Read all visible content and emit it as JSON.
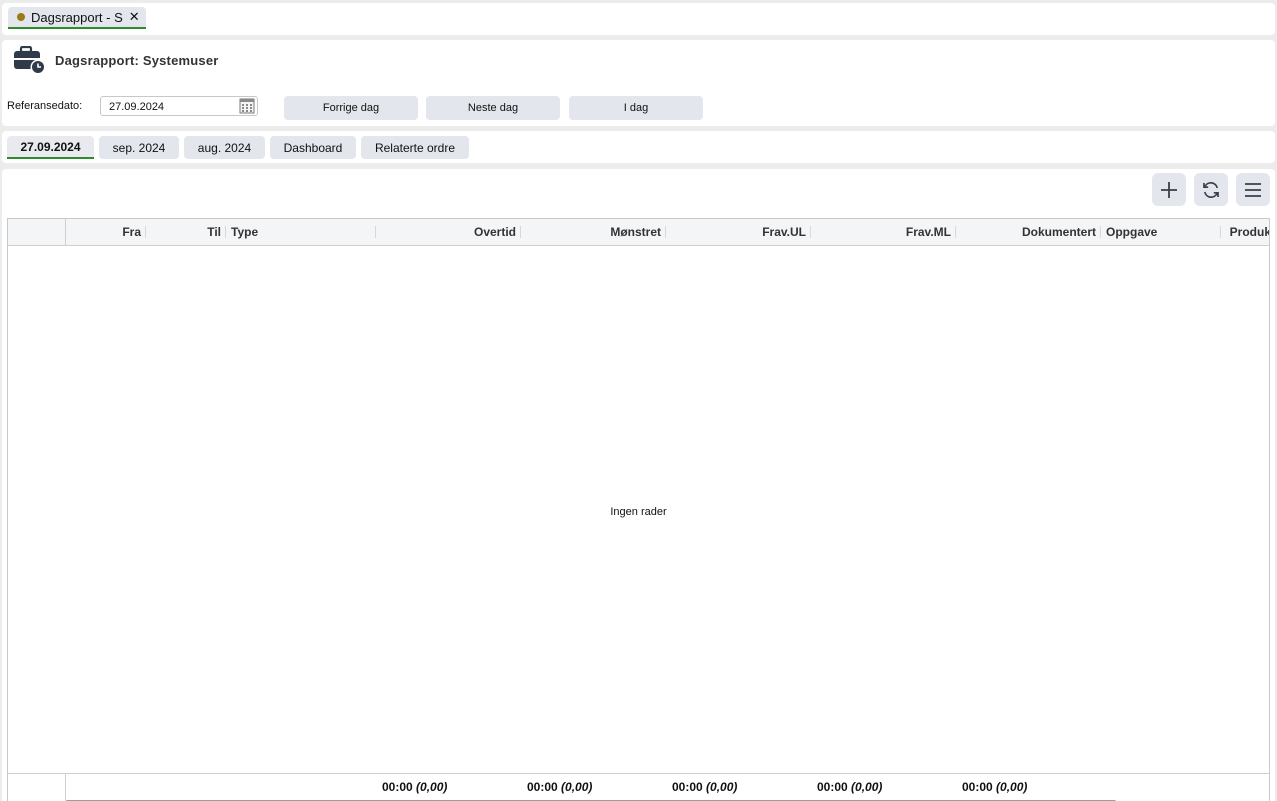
{
  "tabbar": {
    "tab_label": "Dagsrapport - S",
    "close_glyph": "✕",
    "dot_color": "#9a7b12"
  },
  "header": {
    "title": "Dagsrapport: Systemuser",
    "ref_label": "Referansedato:",
    "date_value": "27.09.2024",
    "buttons": {
      "prev": "Forrige dag",
      "next": "Neste dag",
      "today": "I dag"
    }
  },
  "subtabs": [
    "27.09.2024",
    "sep. 2024",
    "aug. 2024",
    "Dashboard",
    "Relaterte ordre"
  ],
  "toolbar": {
    "icons": [
      "plus-icon",
      "refresh-icon",
      "menu-icon"
    ]
  },
  "grid": {
    "columns": [
      "Fra",
      "Til",
      "Type",
      "Overtid",
      "Mønstret",
      "Frav.UL",
      "Frav.ML",
      "Dokumentert",
      "Oppgave",
      "Produk"
    ],
    "empty_text": "Ingen rader",
    "totals": [
      {
        "value": "00:00",
        "hours": "(0,00)"
      },
      {
        "value": "00:00",
        "hours": "(0,00)"
      },
      {
        "value": "00:00",
        "hours": "(0,00)"
      },
      {
        "value": "00:00",
        "hours": "(0,00)"
      },
      {
        "value": "00:00",
        "hours": "(0,00)"
      }
    ]
  },
  "colors": {
    "accent_green": "#2e8b2e",
    "button_bg": "#e3e6ec",
    "icon_dark": "#2f3a4a"
  }
}
